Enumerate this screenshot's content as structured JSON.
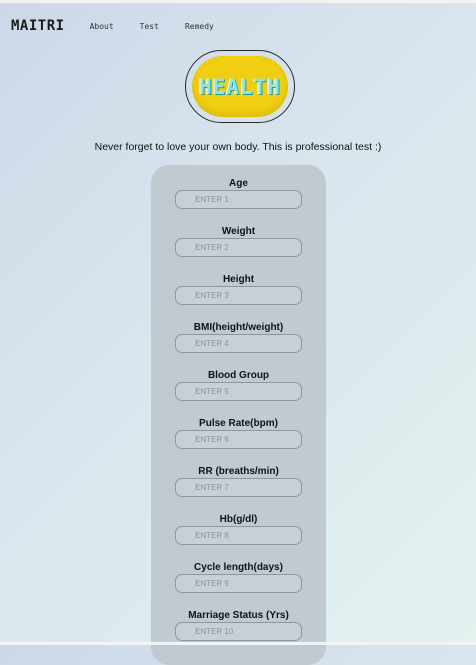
{
  "nav": {
    "brand": "MAITRI",
    "links": [
      "About",
      "Test",
      "Remedy"
    ]
  },
  "logo": {
    "text": "HEALTH"
  },
  "tagline": "Never forget to love your own body. This is professional test :)",
  "form": {
    "fields": [
      {
        "label": "Age",
        "placeholder": "ENTER 1"
      },
      {
        "label": "Weight",
        "placeholder": "ENTER 2"
      },
      {
        "label": "Height",
        "placeholder": "ENTER 3"
      },
      {
        "label": "BMI(height/weight)",
        "placeholder": "ENTER 4"
      },
      {
        "label": "Blood Group",
        "placeholder": "ENTER 5"
      },
      {
        "label": "Pulse Rate(bpm)",
        "placeholder": "ENTER 6"
      },
      {
        "label": "RR (breaths/min)",
        "placeholder": "ENTER 7"
      },
      {
        "label": "Hb(g/dl)",
        "placeholder": "ENTER 8"
      },
      {
        "label": "Cycle length(days)",
        "placeholder": "ENTER 9"
      },
      {
        "label": "Marriage Status (Yrs)",
        "placeholder": "ENTER 10"
      }
    ]
  },
  "colors": {
    "logo_fill": "#f0cf12",
    "card": "#c1c9d1"
  }
}
